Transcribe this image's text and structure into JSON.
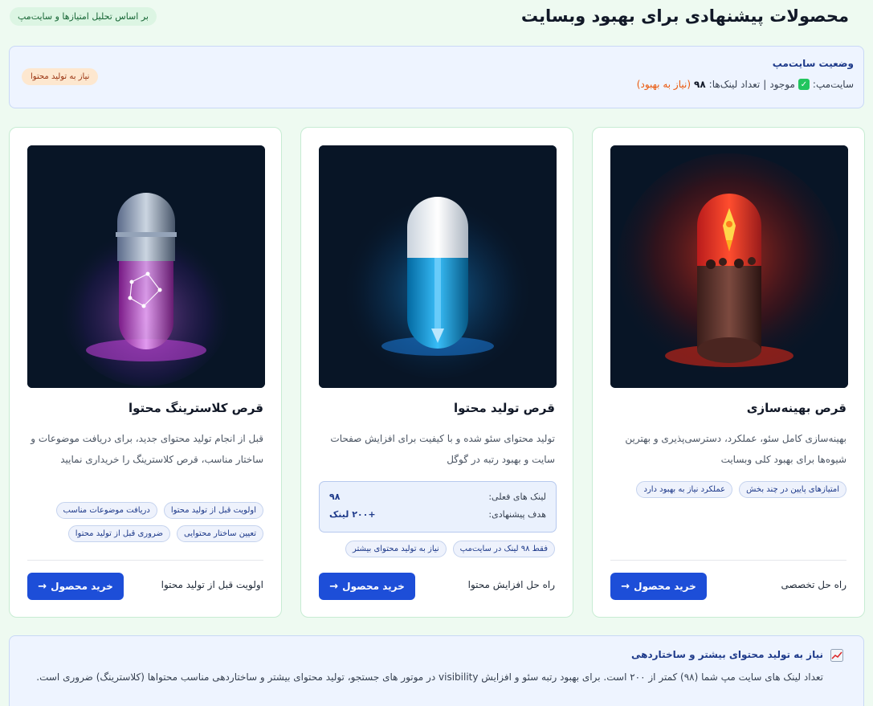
{
  "header": {
    "title": "محصولات پیشنهادی برای بهبود وبسایت",
    "basis_pill": "بر اساس تحلیل امتیازها و سایت‌مپ"
  },
  "sitemap": {
    "title": "وضعیت سایت‌مپ",
    "status_prefix": "سایت‌مپ:",
    "status_value": "موجود",
    "separator": "|",
    "links_label": "تعداد لینک‌ها:",
    "links_count": "۹۸",
    "needs_improvement": "(نیاز به بهبود)",
    "badge": "نیاز به تولید محتوا"
  },
  "cards": [
    {
      "title": "قرص بهینه‌سازی",
      "desc": "بهینه‌سازی کامل سئو، عملکرد، دسترسی‌پذیری و بهترین شیوه‌ها برای بهبود کلی وبسایت",
      "tags": [
        "امتیازهای پایین در چند بخش",
        "عملکرد نیاز به بهبود دارد"
      ],
      "footer_label": "راه حل تخصصی",
      "button": "خرید محصول",
      "pill_color": "#e11d0e"
    },
    {
      "title": "قرص تولید محتوا",
      "desc": "تولید محتوای سئو شده و با کیفیت برای افزایش صفحات سایت و بهبود رتبه در گوگل",
      "stats": {
        "current_label": "لینک های فعلی:",
        "current_value": "۹۸",
        "target_label": "هدف پیشنهادی:",
        "target_value": "+۲۰۰ لینک"
      },
      "tags": [
        "فقط ۹۸ لینک در سایت‌مپ",
        "نیاز به تولید محتوای بیشتر"
      ],
      "footer_label": "راه حل افزایش محتوا",
      "button": "خرید محصول",
      "pill_color": "#0ea5e9"
    },
    {
      "title": "قرص کلاسترینگ محتوا",
      "desc": "قبل از انجام تولید محتوای جدید، برای دریافت موضوعات و ساختار مناسب، قرص کلاسترینگ را خریداری نمایید",
      "tags": [
        "اولویت قبل از تولید محتوا",
        "دریافت موضوعات مناسب",
        "تعیین ساختار محتوایی",
        "ضروری قبل از تولید محتوا"
      ],
      "footer_label": "اولویت قبل از تولید محتوا",
      "button": "خرید محصول",
      "pill_color": "#d946ef"
    }
  ],
  "bottom": {
    "title": "نیاز به تولید محتوای بیشتر و ساختاردهی",
    "text": "تعداد لینک های سایت مپ شما (۹۸) کمتر از ۲۰۰ است. برای بهبود رتبه سئو و افزایش visibility در موتور های جستجو، تولید محتوای بیشتر و ساختاردهی مناسب محتواها (کلاسترینگ) ضروری است."
  }
}
